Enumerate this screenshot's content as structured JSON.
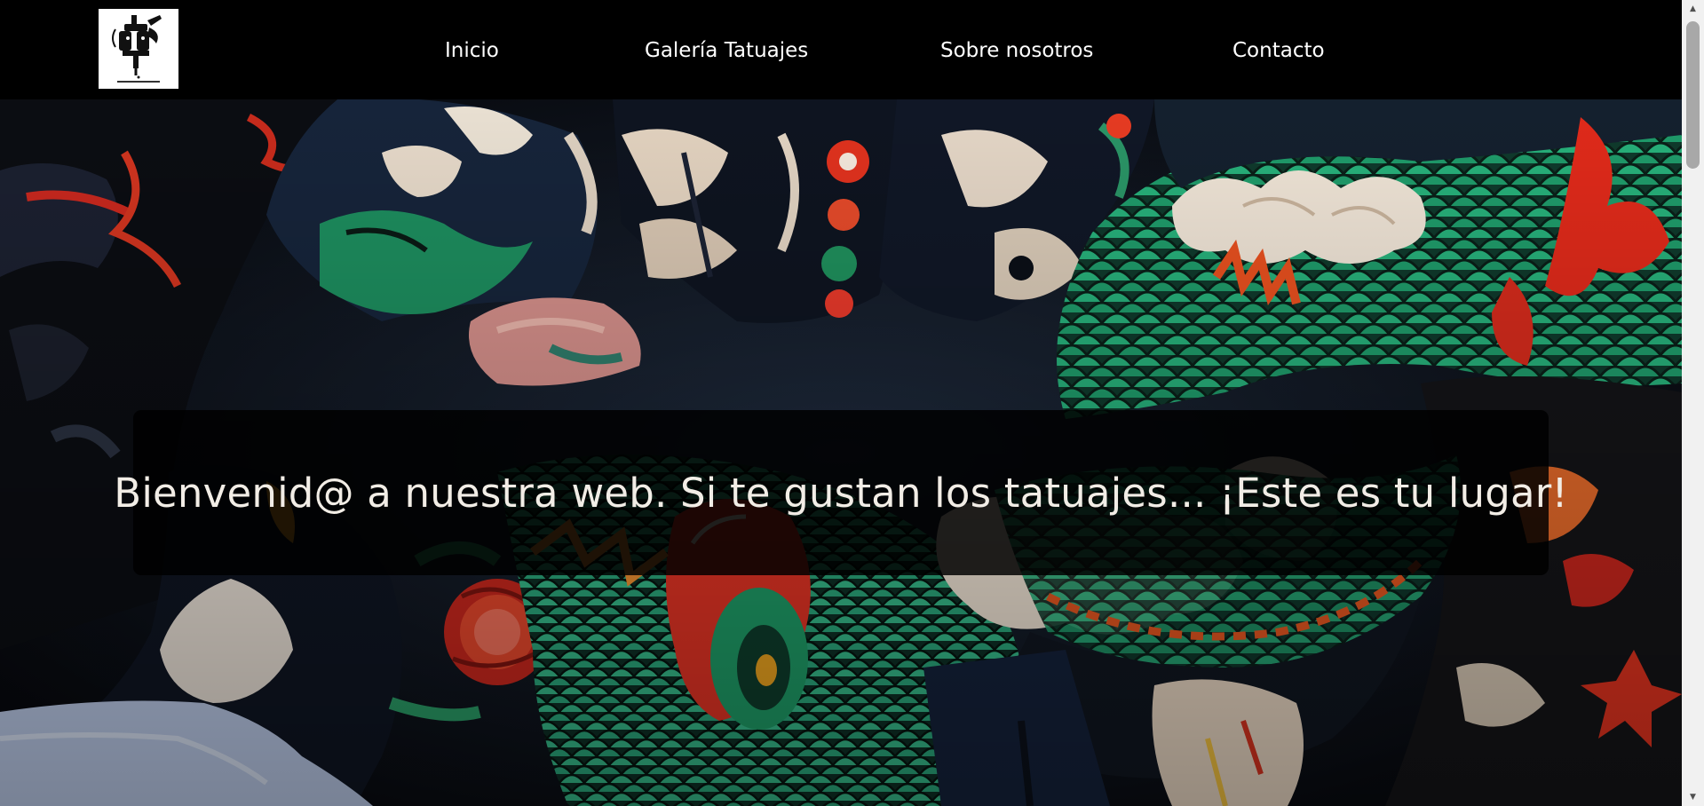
{
  "header": {
    "logo_label": "tattoo-machine-logo",
    "nav": [
      {
        "label": "Inicio"
      },
      {
        "label": "Galería Tatuajes"
      },
      {
        "label": "Sobre nosotros"
      },
      {
        "label": "Contacto"
      }
    ]
  },
  "hero": {
    "image_subject": "tattooed-arms-photo",
    "headline": "Bienvenid@ a nuestra web. Si te gustan los tatuajes... ¡Este es tu lugar!"
  },
  "colors": {
    "header_bg": "#000000",
    "nav_text": "#ffffff",
    "banner_bg": "rgba(0,0,0,0.84)",
    "headline_text": "#f2ede6"
  },
  "scrollbar": {
    "up_icon": "arrow-up-icon",
    "down_icon": "arrow-down-icon"
  }
}
